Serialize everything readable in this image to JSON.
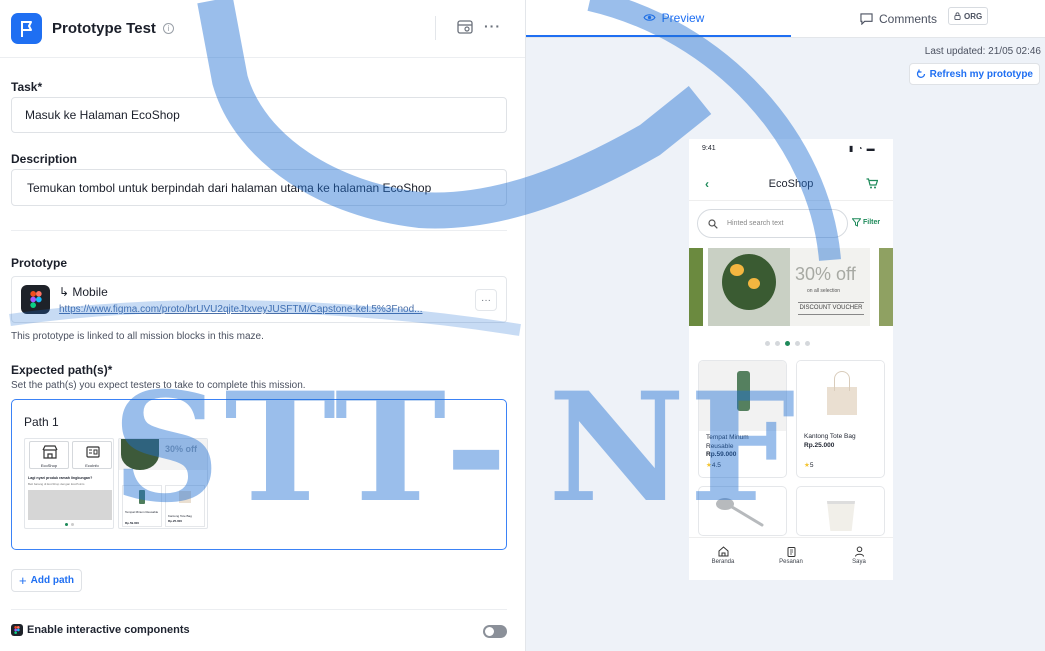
{
  "header": {
    "title": "Prototype Test",
    "info_icon": "info-icon",
    "preview_icon": "preview-eye-icon",
    "more_icon": "more-dots-icon"
  },
  "task": {
    "label": "Task*",
    "value": "Masuk ke Halaman EcoShop"
  },
  "description": {
    "label": "Description",
    "value": "Temukan tombol untuk berpindah dari halaman utama ke halaman EcoShop"
  },
  "prototype": {
    "label": "Prototype",
    "name": "↳ Mobile",
    "url": "https://www.figma.com/proto/brUVU2qjteJtxveyJUSFTM/Capstone-kel.5%3Fnod...",
    "note": "This prototype is linked to all mission blocks in this maze.",
    "more": "···"
  },
  "expected": {
    "label": "Expected path(s)*",
    "help": "Set the path(s) you expect testers to take to complete this mission.",
    "path_name": "Path 1",
    "thumb1": {
      "tile1": "EcoShop",
      "tile2": "EcoInfo",
      "headline": "Lagi nyari produk ramah lingkungan?",
      "sub": "Beli barang di EcoShop dengan EcoPoints"
    },
    "thumb2": {
      "promo": "30% off",
      "card1": "Tempat Minum Reusable",
      "card1_price": "Rp.59.000",
      "card2": "Kantong Tote Bag",
      "card2_price": "Rp.25.000"
    }
  },
  "add_path": "Add path",
  "interactive": {
    "label": "Enable interactive components",
    "enabled": false
  },
  "tabs": {
    "preview": "Preview",
    "comments": "Comments",
    "org": "ORG"
  },
  "updated": "Last updated: 21/05 02:46",
  "refresh": "Refresh my prototype",
  "phone": {
    "time": "9:41",
    "title": "EcoShop",
    "search_placeholder": "Hinted search text",
    "filter": "Filter",
    "banner": {
      "discount": "30% off",
      "sub": "on all selection",
      "voucher": "DISCOUNT VOUCHER"
    },
    "products": [
      {
        "name": "Tempat Minum Reusable",
        "price": "Rp.59.000",
        "rating": "4.5"
      },
      {
        "name": "Kantong Tote Bag",
        "price": "Rp.25.000",
        "rating": "5"
      }
    ],
    "nav": [
      "Beranda",
      "Pesanan",
      "Saya"
    ]
  },
  "watermark": {
    "left": "STT",
    "dash": "-",
    "right": "NF"
  },
  "colors": {
    "accent": "#1f6ff2",
    "eco_green": "#1e8a5a"
  }
}
